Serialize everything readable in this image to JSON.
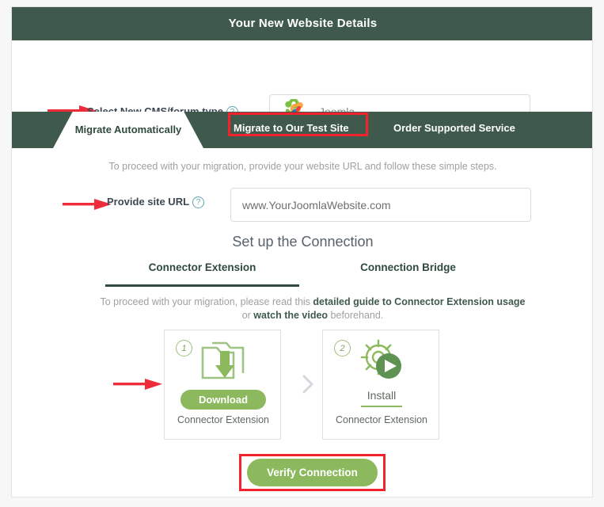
{
  "header": {
    "title": "Your New Website Details"
  },
  "cms_row": {
    "label": "Select New CMS/forum type",
    "help_icon": "question-mark-icon",
    "arrow_icon": "red-right-arrow-icon",
    "select": {
      "logo_icon": "joomla-logo-icon",
      "value": "Joomla",
      "caret_icon": "chevron-down-icon"
    }
  },
  "tabs": {
    "items": [
      {
        "label": "Migrate Automatically",
        "active": true,
        "highlighted": false
      },
      {
        "label": "Migrate to Our Test Site",
        "active": false,
        "highlighted": true
      },
      {
        "label": "Order Supported Service",
        "active": false,
        "highlighted": false
      }
    ],
    "highlight_color": "#f5222d",
    "bar_color": "#3f5a4c"
  },
  "panel": {
    "intro": "To proceed with your migration, provide your website URL and follow these simple steps.",
    "url": {
      "label": "Provide site URL",
      "help_icon": "question-mark-icon",
      "arrow_icon": "red-right-arrow-icon",
      "value": "www.YourJoomlaWebsite.com",
      "placeholder": "www.YourJoomlaWebsite.com"
    },
    "setup_title": "Set up the Connection",
    "subtabs": [
      {
        "label": "Connector Extension",
        "active": true
      },
      {
        "label": "Connection Bridge",
        "active": false
      }
    ],
    "guide": {
      "prefix": "To proceed with your migration, please read this ",
      "link1": "detailed guide to Connector Extension usage",
      "middle": " or ",
      "link2": "watch the video",
      "suffix": " beforehand."
    },
    "steps": [
      {
        "number": "1",
        "icon": "folder-download-icon",
        "action": "Download",
        "caption": "Connector Extension"
      },
      {
        "number": "2",
        "icon": "gear-play-install-icon",
        "action": "Install",
        "caption": "Connector Extension"
      }
    ],
    "step_separator_icon": "chevron-right-icon",
    "arrow_icon": "red-right-arrow-icon",
    "verify": {
      "label": "Verify Connection",
      "button_color": "#8cb95e",
      "highlight_color": "#f5222d"
    }
  }
}
